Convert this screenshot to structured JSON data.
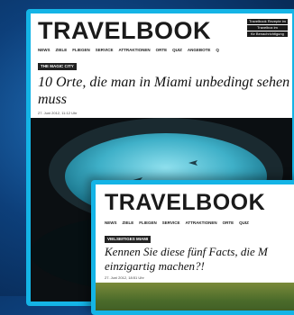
{
  "back_article": {
    "logo": "TRAVELBOOK",
    "top_buttons": [
      "Travelbook Rezepte im",
      "Travelbox im",
      "für Benachrichtigung"
    ],
    "nav": [
      "NEWS",
      "ZIELE",
      "FLIEGEN",
      "SERVICE",
      "ATTRAKTIONEN",
      "ORTE",
      "QUIZ",
      "ANGEBOTE",
      "Q"
    ],
    "category": "THE MAGIC CITY",
    "headline": "10 Orte, die man in Miami unbedingt sehen muss",
    "date": "27. Juni 2012, 11:12 Uhr"
  },
  "front_article": {
    "logo": "TRAVELBOOK",
    "nav": [
      "NEWS",
      "ZIELE",
      "FLIEGEN",
      "SERVICE",
      "ATTRAKTIONEN",
      "ORTE",
      "QUIZ"
    ],
    "category": "VIELSEITIGES MIAMI",
    "headline_line1": "Kennen Sie diese fünf Facts, die M",
    "headline_line2": "einzigartig machen?!",
    "date": "27. Juni 2012, 18:51 Uhr"
  },
  "colors": {
    "frame_accent": "#14b4e6",
    "background": "#0d3f7a",
    "aquarium_water": "#3fb0c8"
  }
}
